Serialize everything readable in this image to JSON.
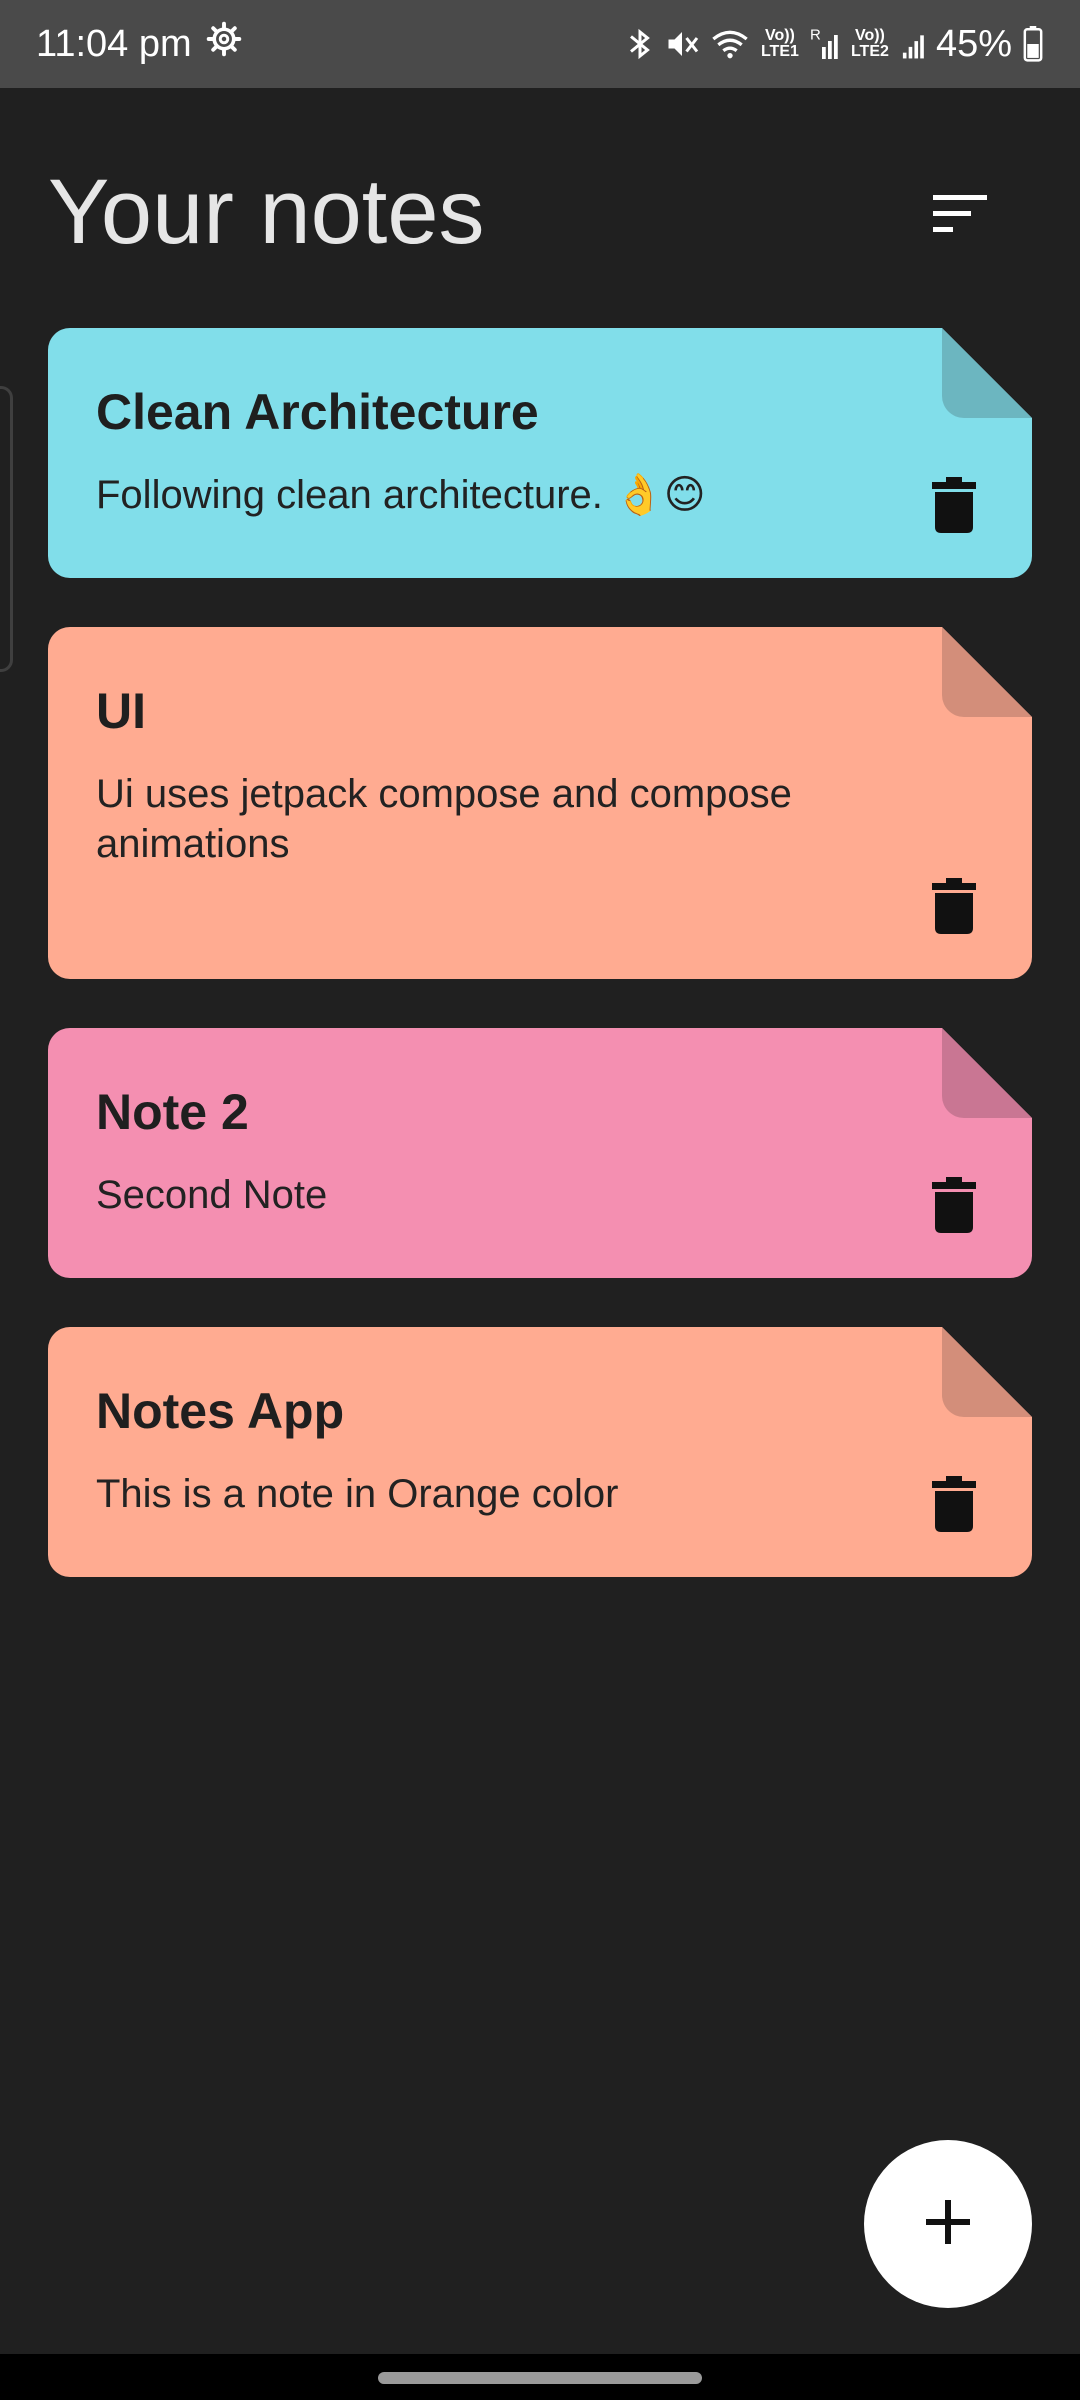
{
  "status_bar": {
    "time": "11:04 pm",
    "battery": "45%",
    "sim1_label": "Vo)) LTE1",
    "sim2_label": "Vo)) LTE2",
    "roaming": "R"
  },
  "header": {
    "title": "Your notes"
  },
  "notes": [
    {
      "title": "Clean Architecture",
      "body": "Following clean architecture. 👌😊",
      "color": "#81DEEA",
      "fold_color": "#6CB6C0"
    },
    {
      "title": "UI",
      "body": "Ui uses jetpack compose and compose animations",
      "color": "#FFAB91",
      "fold_color": "#D38E7A"
    },
    {
      "title": "Note 2",
      "body": "Second Note",
      "color": "#F48FB1",
      "fold_color": "#C97693"
    },
    {
      "title": "Notes App",
      "body": "This is a note in Orange color",
      "color": "#FFAB91",
      "fold_color": "#D38E7A"
    }
  ],
  "fab": {
    "label": "+"
  },
  "icons": {
    "sort": "sort-icon",
    "delete": "trash-icon",
    "add": "plus-icon",
    "settings": "gear-icon"
  }
}
